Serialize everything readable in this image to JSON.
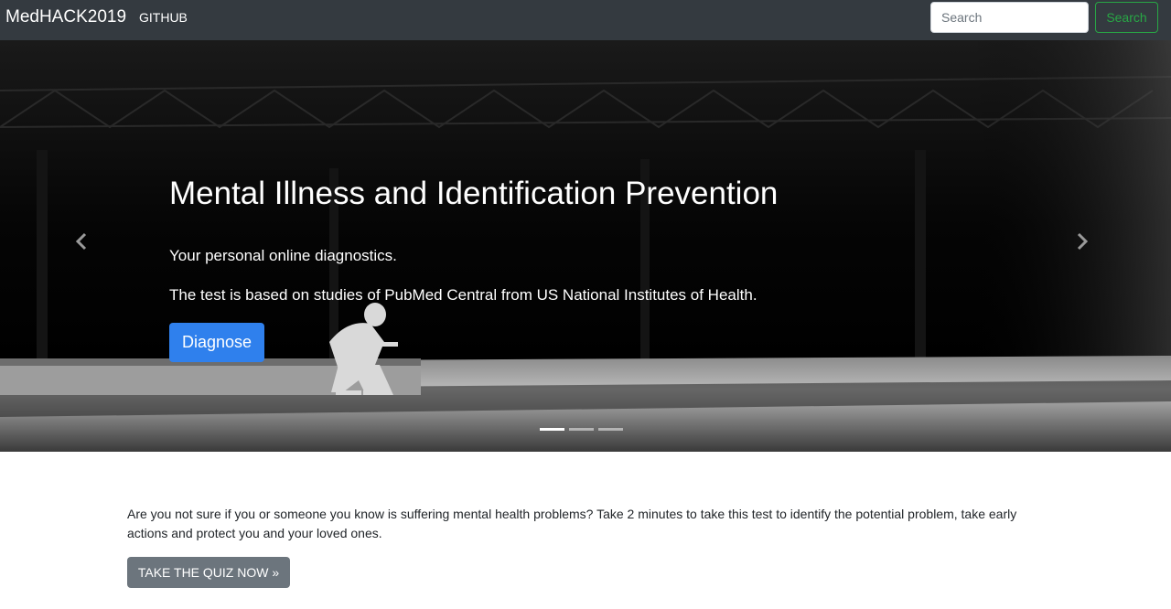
{
  "navbar": {
    "brand": "MedHACK2019",
    "links": [
      {
        "label": "GITHUB"
      }
    ],
    "search": {
      "placeholder": "Search",
      "button_label": "Search"
    }
  },
  "carousel": {
    "title": "Mental Illness and Identification Prevention",
    "subtitle": "Your personal online diagnostics.",
    "text": "The test is based on studies of PubMed Central from US National Institutes of Health.",
    "cta_label": "Diagnose",
    "slide_count": 3,
    "active_slide": 1,
    "prev_icon": "chevron-left-icon",
    "next_icon": "chevron-right-icon"
  },
  "intro": {
    "text": "Are you not sure if you or someone you know is suffering mental health problems? Take 2 minutes to take this test to identify the potential problem, take early actions and protect you and your loved ones.",
    "button_label": "TAKE THE QUIZ NOW »"
  },
  "colors": {
    "navbar_bg": "#343a40",
    "search_accent": "#28a745",
    "primary": "#2f80ed",
    "secondary": "#6c757d"
  }
}
